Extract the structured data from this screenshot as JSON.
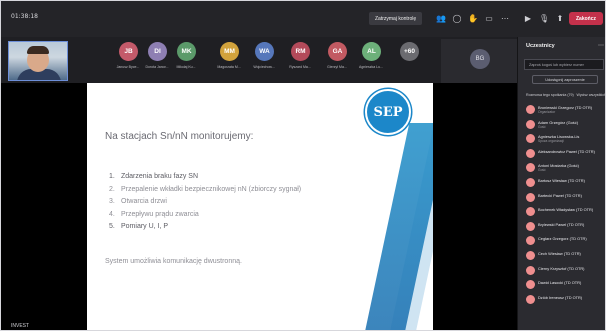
{
  "topbar": {
    "timer": "01:38:18",
    "raise_hand_label": "Zatrzymaj kontrolę",
    "end_label": "Zakończ"
  },
  "strip": {
    "participants": [
      {
        "initials": "JB",
        "name": "Janusz Byce...",
        "color": "#c45a6a"
      },
      {
        "initials": "DI",
        "name": "Dorota Janor...",
        "color": "#8e7fb3"
      },
      {
        "initials": "MK",
        "name": "Mikołaj Ku...",
        "color": "#5b9a6a"
      },
      {
        "initials": "MM",
        "name": "Magorzata M...",
        "color": "#d1a23c"
      },
      {
        "initials": "WA",
        "name": "Wojciechow...",
        "color": "#5677bb"
      },
      {
        "initials": "RM",
        "name": "Ryszard Ma...",
        "color": "#b34a5a"
      },
      {
        "initials": "GA",
        "name": "Gierzył Ma...",
        "color": "#c25a62"
      },
      {
        "initials": "AL",
        "name": "Agnieszka Lu...",
        "color": "#6db07a"
      },
      {
        "initials": "+60",
        "name": "",
        "color": "#6b6b70"
      }
    ],
    "bg_initials": "BG"
  },
  "slide": {
    "title": "Na stacjach Sn/nN monitorujemy:",
    "items": [
      {
        "num": "1.",
        "text": "Zdarzenia braku fazy SN",
        "style": "dark"
      },
      {
        "num": "2.",
        "text": "Przepalenie wkładki bezpiecznikowej nN (zbiorczy sygnał)",
        "style": "light"
      },
      {
        "num": "3.",
        "text": "Otwarcia drzwi",
        "style": "light"
      },
      {
        "num": "4.",
        "text": "Przepływu prądu zwarcia",
        "style": "light"
      },
      {
        "num": "5.",
        "text": "Pomiary U, I, P",
        "style": "dark"
      }
    ],
    "footer": "System umożliwia komunikację dwustronną.",
    "logo": "SEP"
  },
  "bottom_label": "INVEST",
  "panel": {
    "title": "Uczestnicy",
    "invite_placeholder": "Zaproś kogoś lub wybierz numer",
    "share_label": "Udostępnij zaproszenie",
    "section_head": "Rozmowa tego spotkania (79)",
    "mute_all": "Wycisz wszystkich",
    "people": [
      {
        "name": "Broniewski Grzegorz (TD OTR)",
        "role": "Organizator"
      },
      {
        "name": "Adam Grzegórz (Gość)",
        "role": "Gość"
      },
      {
        "name": "Agnieszka Lisowska-Lis",
        "role": "Spoza organizacji"
      },
      {
        "name": "Aleksandrowicz Paweł (TD OTR)",
        "role": ""
      },
      {
        "name": "Antoni Mostarka (Gość)",
        "role": "Gość"
      },
      {
        "name": "Bartosz Wiesław (TD OTR)",
        "role": ""
      },
      {
        "name": "Bartecki Paweł (TD OTR)",
        "role": ""
      },
      {
        "name": "Bochenek Władysław (TD OTR)",
        "role": ""
      },
      {
        "name": "Brylewski Paweł (TD OTR)",
        "role": ""
      },
      {
        "name": "Cegłarz Grzegorz (TD OTR)",
        "role": ""
      },
      {
        "name": "Cech Wiesław (TD OTR)",
        "role": ""
      },
      {
        "name": "Cierny Krzysztof (TD OTR)",
        "role": ""
      },
      {
        "name": "Dawid Lasocki (TD OTR)",
        "role": ""
      },
      {
        "name": "Dziób Ireneusz (TD OTR)",
        "role": ""
      }
    ]
  }
}
